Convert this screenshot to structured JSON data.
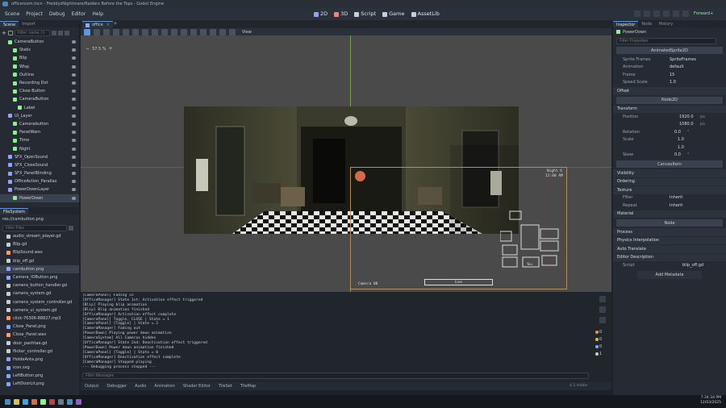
{
  "window": {
    "title": "officeroom.tscn - FreddysNightmare/Raiders Before the Tops - Godot Engine"
  },
  "menu": [
    "Scene",
    "Project",
    "Debug",
    "Editor",
    "Help"
  ],
  "workspaces": [
    {
      "label": "2D",
      "color": "#8da5f3"
    },
    {
      "label": "3D",
      "color": "#fc7f7f"
    },
    {
      "label": "Script",
      "color": "#c9ced6"
    },
    {
      "label": "Game",
      "color": "#c9ced6"
    },
    {
      "label": "AssetLib",
      "color": "#c9ced6"
    }
  ],
  "renderer": "Forward+",
  "scene_dock": {
    "tabs": [
      "Scene",
      "Import"
    ],
    "filter_placeholder": "Filter: name, t:t",
    "nodes": [
      {
        "name": "CameraButton",
        "depth": 1,
        "color": "#8eef97"
      },
      {
        "name": "Static",
        "depth": 2,
        "color": "#8eef97"
      },
      {
        "name": "Blip",
        "depth": 2,
        "color": "#8eef97"
      },
      {
        "name": "Wisp",
        "depth": 2,
        "color": "#8eef97"
      },
      {
        "name": "Outline",
        "depth": 2,
        "color": "#8eef97"
      },
      {
        "name": "Recording Dot",
        "depth": 2,
        "color": "#8eef97"
      },
      {
        "name": "Close Button",
        "depth": 2,
        "color": "#8eef97"
      },
      {
        "name": "CameraButton",
        "depth": 2,
        "color": "#8eef97"
      },
      {
        "name": "Label",
        "depth": 3,
        "color": "#8eef97"
      },
      {
        "name": "UI_Layer",
        "depth": 1,
        "color": "#8da5f3"
      },
      {
        "name": "Camerabutton",
        "depth": 2,
        "color": "#8eef97"
      },
      {
        "name": "PanelWarn",
        "depth": 2,
        "color": "#8eef97"
      },
      {
        "name": "Time",
        "depth": 2,
        "color": "#8eef97"
      },
      {
        "name": "Night",
        "depth": 2,
        "color": "#8eef97"
      },
      {
        "name": "SFX_OpenSound",
        "depth": 1,
        "color": "#8da5f3"
      },
      {
        "name": "SFX_CloseSound",
        "depth": 1,
        "color": "#8da5f3"
      },
      {
        "name": "SFX_PanelBlinding",
        "depth": 1,
        "color": "#8da5f3"
      },
      {
        "name": "OfficeAction_Parallax",
        "depth": 1,
        "color": "#8da5f3"
      },
      {
        "name": "PowerDownLayer",
        "depth": 1,
        "color": "#8da5f3"
      },
      {
        "name": "PowerDown",
        "depth": 2,
        "color": "#8eef97"
      }
    ]
  },
  "filesystem": {
    "title": "FileSystem",
    "path": "res://cambutton.png",
    "filter_placeholder": "Filter Files",
    "files": [
      {
        "name": "audio_stream_player.gd",
        "color": "#c9ced6"
      },
      {
        "name": "Blip.gd",
        "color": "#c9ced6"
      },
      {
        "name": "BlipSound.wav",
        "color": "#fc9c6b"
      },
      {
        "name": "blip_off.gd",
        "color": "#c9ced6"
      },
      {
        "name": "cambutton.png",
        "color": "#8da5f3"
      },
      {
        "name": "Camera_IOButton.png",
        "color": "#8da5f3"
      },
      {
        "name": "camera_button_handler.gd",
        "color": "#c9ced6"
      },
      {
        "name": "camera_system.gd",
        "color": "#c9ced6"
      },
      {
        "name": "camera_system_controller.gd",
        "color": "#c9ced6"
      },
      {
        "name": "camera_ui_system.gd",
        "color": "#c9ced6"
      },
      {
        "name": "click-76306-88827.mp3",
        "color": "#fc9c6b"
      },
      {
        "name": "Close_Panel.png",
        "color": "#8da5f3"
      },
      {
        "name": "Close_Panel.wav",
        "color": "#fc9c6b"
      },
      {
        "name": "door_panhtae.gd",
        "color": "#c9ced6"
      },
      {
        "name": "flicker_controller.gd",
        "color": "#c9ced6"
      },
      {
        "name": "HoldeAnta.png",
        "color": "#8da5f3"
      },
      {
        "name": "icon.svg",
        "color": "#8da5f3"
      },
      {
        "name": "LeftButton.png",
        "color": "#8da5f3"
      },
      {
        "name": "LeftDoorLit.png",
        "color": "#8da5f3"
      }
    ]
  },
  "editor_tabs": [
    {
      "label": "office"
    }
  ],
  "viewport": {
    "toolbar_view": "View",
    "zoom": "37.5 %",
    "camera_overlay": {
      "night": "Night 6",
      "time": "12:00 AM",
      "camera": "Camera 08",
      "map_label": "Live",
      "you_label": "You"
    }
  },
  "output": {
    "lines": [
      "[CameraPanel] Fading in",
      "[OfficeManager] State 1st: Activation effect triggered",
      "[Blip] Playing blip animation",
      "[Blip] Blip animation finished",
      "[OfficeManager] Activation effect complete",
      "[CameraPanel] Toggle, CLOSE | State = 1",
      "[CameraPanel] [Toggle] | State = 2",
      "[CameraManager] Fading out",
      "[PowerDown] Playing power down animation",
      "[CameraSystem] All Cameras hidden",
      "[OfficeManager] State 2nd: Deactivation effect triggered",
      "[PowerDown] Power down animation finished",
      "[CameraPanel] [Toggle] | State = 0",
      "[OfficeManager] Deactivation effect complete",
      "[CameraManager] Stopped playing",
      "--- Debugging process stopped ---"
    ],
    "filter_placeholder": "Filter Messages",
    "badges": [
      "0",
      "0",
      "0",
      "1"
    ]
  },
  "bottom_panel": {
    "tabs": [
      "Output",
      "Debugger",
      "Audio",
      "Animation",
      "Shader Editor",
      "TileSet",
      "TileMap"
    ],
    "version": "4.5.stable"
  },
  "inspector": {
    "tabs": [
      "Inspector",
      "Node",
      "History"
    ],
    "node_name": "PowerDown",
    "filter_placeholder": "Filter Properties",
    "class_header": "AnimatedSprite2D",
    "props": [
      {
        "key": "Sprite Frames",
        "value": "SpriteFrames"
      },
      {
        "key": "Animation",
        "value": "default"
      },
      {
        "key": "Frame",
        "value": "15"
      },
      {
        "key": "Speed Scale",
        "value": "1.0"
      }
    ],
    "offset_label": "Offset",
    "offset_value": "Node2D",
    "transform_label": "Transform",
    "position": {
      "label": "Position",
      "x": "1920.0",
      "y": "1080.0",
      "unit": "px"
    },
    "rotation": {
      "label": "Rotation",
      "value": "0.0",
      "unit": "°"
    },
    "scale": {
      "label": "Scale",
      "x": "1.0",
      "y": "1.0"
    },
    "skew": {
      "label": "Skew",
      "value": "0.0",
      "unit": "°"
    },
    "canvas_label": "CanvasItem",
    "sections": [
      "Visibility",
      "Ordering",
      "Texture"
    ],
    "filter": {
      "label": "Filter",
      "value": "Inherit"
    },
    "repeat": {
      "label": "Repeat",
      "value": "Inherit"
    },
    "material_label": "Material",
    "node_label": "Node",
    "sections2": [
      "Process",
      "Physics Interpolation",
      "Auto Translate",
      "Editor Description"
    ],
    "script": {
      "label": "Script",
      "value": "blip_off.gd"
    },
    "add_metadata": "Add Metadata"
  },
  "taskbar": {
    "time": "7:34:34 PM",
    "date": "12/03/2025"
  }
}
